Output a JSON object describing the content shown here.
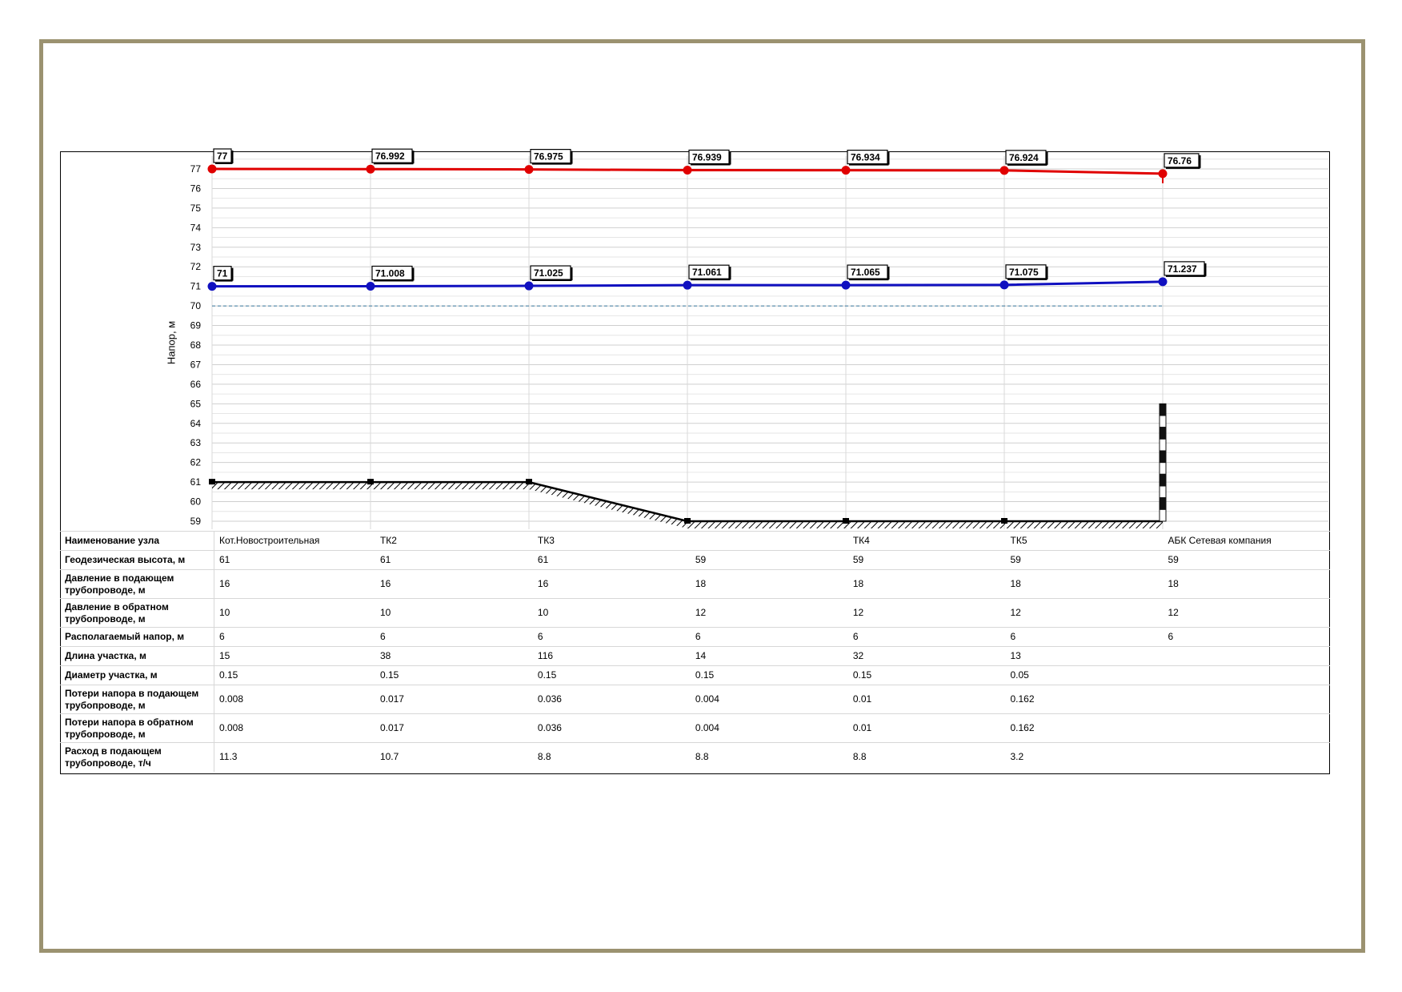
{
  "chart_data": {
    "type": "line",
    "ylabel": "Напор, м",
    "ylim": [
      59,
      77
    ],
    "yticks": [
      59,
      60,
      61,
      62,
      63,
      64,
      65,
      66,
      67,
      68,
      69,
      70,
      71,
      72,
      73,
      74,
      75,
      76,
      77
    ],
    "grid": true,
    "x_nodes": 7,
    "colors": {
      "supply": "#e00000",
      "return": "#1010c0",
      "terrain": "#000000",
      "reference": "#3a7aa0"
    },
    "series": [
      {
        "key": "supply",
        "values": [
          77,
          76.992,
          76.975,
          76.939,
          76.934,
          76.924,
          76.76
        ],
        "labels": [
          "77",
          "76.992",
          "76.975",
          "76.939",
          "76.934",
          "76.924",
          "76.76"
        ]
      },
      {
        "key": "return",
        "values": [
          71,
          71.008,
          71.025,
          71.061,
          71.065,
          71.075,
          71.237
        ],
        "labels": [
          "71",
          "71.008",
          "71.025",
          "71.061",
          "71.065",
          "71.075",
          "71.237"
        ]
      },
      {
        "key": "terrain",
        "values": [
          61,
          61,
          61,
          59,
          59,
          59,
          59
        ]
      }
    ],
    "reference_level": 70,
    "consumer_marker": {
      "node": 6,
      "from": 59,
      "to": 65
    }
  },
  "table": {
    "rows": [
      {
        "label": "Наименование узла",
        "values": [
          "Кот.Новостроительная",
          "ТК2",
          "ТК3",
          "",
          "ТК4",
          "ТК5",
          "АБК Сетевая компания"
        ]
      },
      {
        "label": "Геодезическая высота, м",
        "values": [
          "61",
          "61",
          "61",
          "59",
          "59",
          "59",
          "59"
        ]
      },
      {
        "label": "Давление в подающем трубопроводе, м",
        "values": [
          "16",
          "16",
          "16",
          "18",
          "18",
          "18",
          "18"
        ]
      },
      {
        "label": "Давление в обратном трубопроводе, м",
        "values": [
          "10",
          "10",
          "10",
          "12",
          "12",
          "12",
          "12"
        ]
      },
      {
        "label": "Располагаемый напор, м",
        "values": [
          "6",
          "6",
          "6",
          "6",
          "6",
          "6",
          "6"
        ]
      },
      {
        "label": "Длина участка, м",
        "values": [
          "15",
          "38",
          "116",
          "14",
          "32",
          "13",
          ""
        ]
      },
      {
        "label": "Диаметр участка, м",
        "values": [
          "0.15",
          "0.15",
          "0.15",
          "0.15",
          "0.15",
          "0.05",
          ""
        ]
      },
      {
        "label": "Потери напора в подающем трубопроводе, м",
        "values": [
          "0.008",
          "0.017",
          "0.036",
          "0.004",
          "0.01",
          "0.162",
          ""
        ]
      },
      {
        "label": "Потери напора в обратном трубопроводе, м",
        "values": [
          "0.008",
          "0.017",
          "0.036",
          "0.004",
          "0.01",
          "0.162",
          ""
        ]
      },
      {
        "label": "Расход в подающем трубопроводе, т/ч",
        "values": [
          "11.3",
          "10.7",
          "8.8",
          "8.8",
          "8.8",
          "3.2",
          ""
        ]
      }
    ]
  }
}
